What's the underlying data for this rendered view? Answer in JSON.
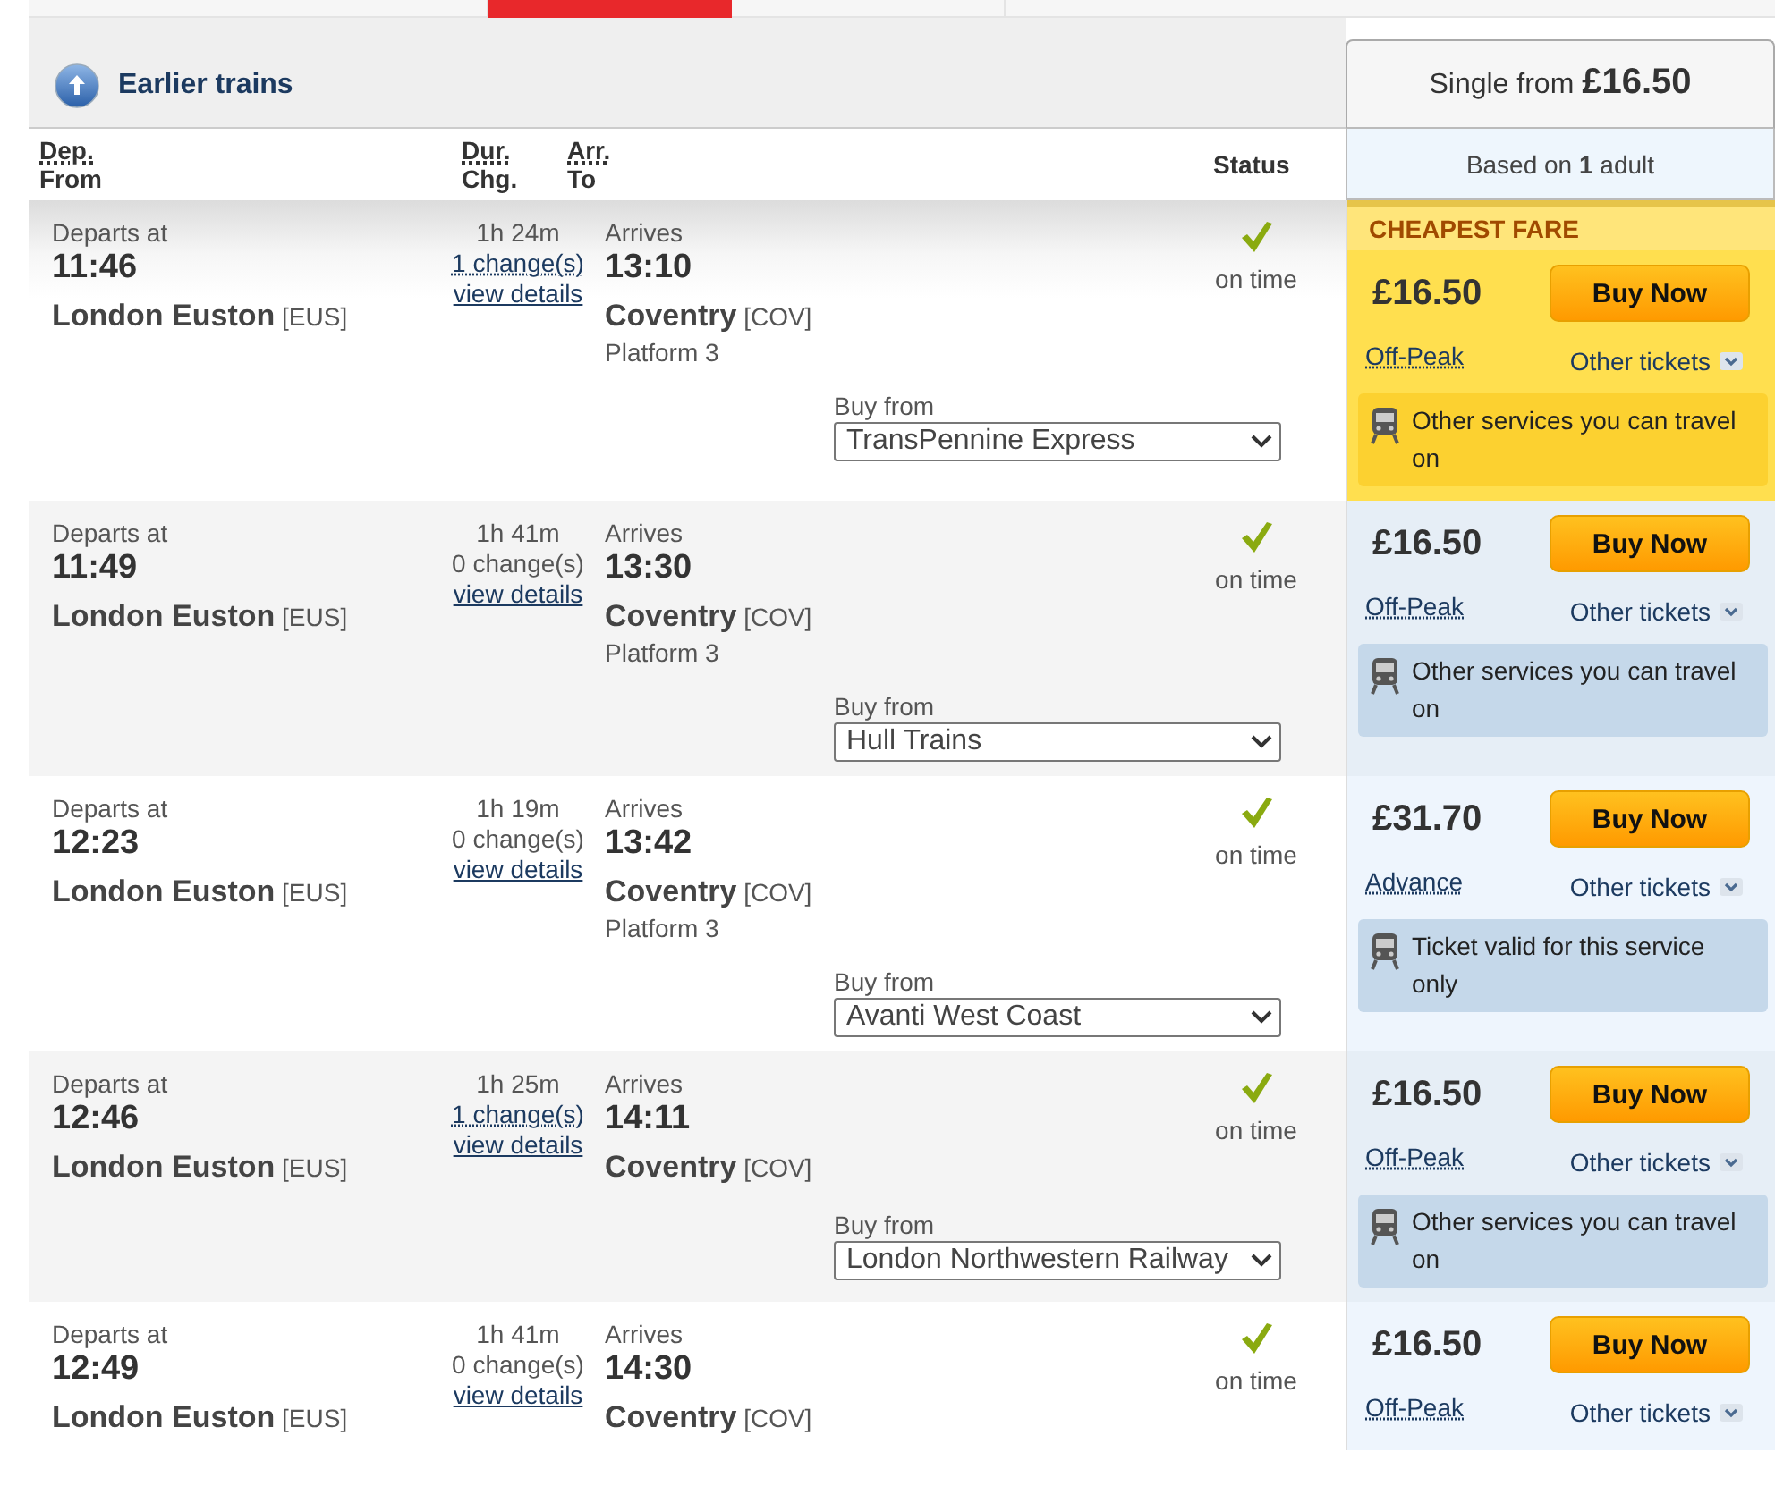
{
  "top_tabs": [
    {
      "selected": false
    },
    {
      "selected": true
    },
    {
      "selected": false
    },
    {
      "selected": false
    }
  ],
  "earlier_trains": {
    "label": "Earlier trains"
  },
  "summary": {
    "single_from": "Single from **£16.50**",
    "based_on": "Based on **1** adult"
  },
  "columns": [
    {
      "kind": "pair",
      "abbr": "Dep.",
      "label": "From"
    },
    {
      "kind": "pair",
      "abbr": "Dur.",
      "label": "Chg."
    },
    {
      "kind": "pair",
      "abbr": "Arr.",
      "label": "To"
    },
    {
      "kind": "plain",
      "label": "Status"
    }
  ],
  "journeys": [
    {
      "depart_label": "Departs at",
      "depart_time": "11:46",
      "from_station": "London Euston",
      "from_code": "[EUS]",
      "duration": "1h 24m",
      "changes": "1 change(s)",
      "changes_dotted": true,
      "details_link": "view details",
      "arrive_label": "Arrives",
      "arrive_time": "13:10",
      "to_station": "Coventry",
      "to_code": "[COV]",
      "platform": "Platform 3",
      "on_time": true,
      "status_text": "on time",
      "buy_from_label": "Buy from",
      "operator": "TransPennine Express",
      "fare": {
        "cheapest": true,
        "banner": "CHEAPEST FARE",
        "price": "£16.50",
        "buy_label": "Buy Now",
        "ticket_type": "Off-Peak",
        "other_tickets": "Other tickets",
        "info": "Other services you can travel on"
      }
    },
    {
      "depart_label": "Departs at",
      "depart_time": "11:49",
      "from_station": "London Euston",
      "from_code": "[EUS]",
      "duration": "1h 41m",
      "changes": "0 change(s)",
      "changes_dotted": false,
      "details_link": "view details",
      "arrive_label": "Arrives",
      "arrive_time": "13:30",
      "to_station": "Coventry",
      "to_code": "[COV]",
      "platform": "Platform 3",
      "on_time": true,
      "status_text": "on time",
      "buy_from_label": "Buy from",
      "operator": "Hull Trains",
      "fare": {
        "cheapest": false,
        "price": "£16.50",
        "buy_label": "Buy Now",
        "ticket_type": "Off-Peak",
        "other_tickets": "Other tickets",
        "info": "Other services you can travel on"
      }
    },
    {
      "depart_label": "Departs at",
      "depart_time": "12:23",
      "from_station": "London Euston",
      "from_code": "[EUS]",
      "duration": "1h 19m",
      "changes": "0 change(s)",
      "changes_dotted": false,
      "details_link": "view details",
      "arrive_label": "Arrives",
      "arrive_time": "13:42",
      "to_station": "Coventry",
      "to_code": "[COV]",
      "platform": "Platform 3",
      "on_time": true,
      "status_text": "on time",
      "buy_from_label": "Buy from",
      "operator": "Avanti West Coast",
      "fare": {
        "cheapest": false,
        "price": "£31.70",
        "buy_label": "Buy Now",
        "ticket_type": "Advance",
        "other_tickets": "Other tickets",
        "info": "Ticket valid for this service only"
      }
    },
    {
      "depart_label": "Departs at",
      "depart_time": "12:46",
      "from_station": "London Euston",
      "from_code": "[EUS]",
      "duration": "1h 25m",
      "changes": "1 change(s)",
      "changes_dotted": true,
      "details_link": "view details",
      "arrive_label": "Arrives",
      "arrive_time": "14:11",
      "to_station": "Coventry",
      "to_code": "[COV]",
      "on_time": true,
      "status_text": "on time",
      "buy_from_label": "Buy from",
      "operator": "London Northwestern Railway",
      "fare": {
        "cheapest": false,
        "price": "£16.50",
        "buy_label": "Buy Now",
        "ticket_type": "Off-Peak",
        "other_tickets": "Other tickets",
        "info": "Other services you can travel on"
      }
    },
    {
      "depart_label": "Departs at",
      "depart_time": "12:49",
      "from_station": "London Euston",
      "from_code": "[EUS]",
      "duration": "1h 41m",
      "changes": "0 change(s)",
      "changes_dotted": false,
      "details_link": "view details",
      "arrive_label": "Arrives",
      "arrive_time": "14:30",
      "to_station": "Coventry",
      "to_code": "[COV]",
      "on_time": true,
      "status_text": "on time",
      "fare": {
        "cheapest": false,
        "price": "£16.50",
        "buy_label": "Buy Now",
        "ticket_type": "Off-Peak",
        "other_tickets": "Other tickets"
      }
    }
  ]
}
